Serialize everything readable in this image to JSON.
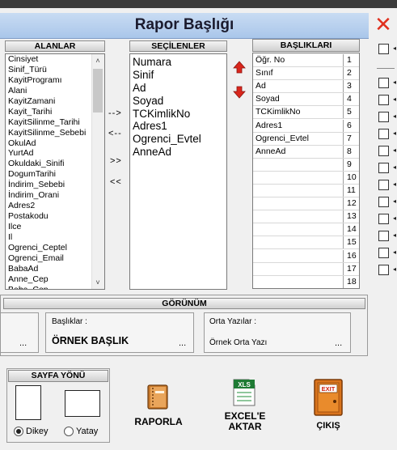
{
  "window": {
    "title": "Rapor Başlığı",
    "close_glyph": "✕"
  },
  "alanlar": {
    "header": "ALANLAR",
    "items": [
      "Cinsiyet",
      "Sinif_Türü",
      "KayitProgramı",
      "Alani",
      "KayitZamani",
      "Kayit_Tarihi",
      "KayitSilinme_Tarihi",
      "KayitSilinme_Sebebi",
      "OkulAd",
      "YurtAd",
      "Okuldaki_Sinifi",
      "DogumTarihi",
      "İndirim_Sebebi",
      "İndirim_Orani",
      "Adres2",
      "Postakodu",
      "Ilce",
      "Il",
      "Ogrenci_Ceptel",
      "Ogrenci_Email",
      "BabaAd",
      "Anne_Cep",
      "Baba_Cep"
    ]
  },
  "transfer": {
    "move_right": "-->",
    "move_left": "<--",
    "move_all_right": ">>",
    "move_all_left": "<<"
  },
  "secilenler": {
    "header": "SEÇİLENLER",
    "items": [
      "Numara",
      "Sinif",
      "Ad",
      "Soyad",
      "TCKimlikNo",
      "Adres1",
      "Ogrenci_Evtel",
      "AnneAd"
    ]
  },
  "order": {
    "up_color": "#d9261c",
    "down_color": "#d9261c"
  },
  "basliklari": {
    "header": "BAŞLIKLARI",
    "rows": [
      {
        "name": "Öğr. No",
        "num": "1"
      },
      {
        "name": "Sınıf",
        "num": "2"
      },
      {
        "name": "Ad",
        "num": "3"
      },
      {
        "name": "Soyad",
        "num": "4"
      },
      {
        "name": "TCKimlikNo",
        "num": "5"
      },
      {
        "name": "Adres1",
        "num": "6"
      },
      {
        "name": "Ogrenci_Evtel",
        "num": "7"
      },
      {
        "name": "AnneAd",
        "num": "8"
      },
      {
        "name": "",
        "num": "9"
      },
      {
        "name": "",
        "num": "10"
      },
      {
        "name": "",
        "num": "11"
      },
      {
        "name": "",
        "num": "12"
      },
      {
        "name": "",
        "num": "13"
      },
      {
        "name": "",
        "num": "14"
      },
      {
        "name": "",
        "num": "15"
      },
      {
        "name": "",
        "num": "16"
      },
      {
        "name": "",
        "num": "17"
      },
      {
        "name": "",
        "num": "18"
      }
    ]
  },
  "gorunum": {
    "header": "GÖRÜNÜM",
    "left_ellipsis": "...",
    "basliklar_label": "Başlıklar :",
    "basliklar_value": "ÖRNEK BAŞLIK",
    "basliklar_ellipsis": "...",
    "orta_label": "Orta Yazılar :",
    "orta_value": "Örnek Orta Yazı",
    "orta_ellipsis": "..."
  },
  "sayfa_yonu": {
    "header": "SAYFA YÖNÜ",
    "dikey_label": "Dikey",
    "yatay_label": "Yatay",
    "selected": "Dikey"
  },
  "actions": {
    "raporla_label": "RAPORLA",
    "excel_label_line1": "EXCEL'E",
    "excel_label_line2": "AKTAR",
    "excel_icon_text": "XLS",
    "cikis_label": "ÇIKIŞ",
    "exit_icon_text": "EXIT"
  },
  "colors": {
    "title_bg": "#b9d1ef",
    "close": "#e0301e",
    "excel_green": "#1e7b34",
    "exit_orange": "#d9731c",
    "book_brown": "#b4611d"
  }
}
